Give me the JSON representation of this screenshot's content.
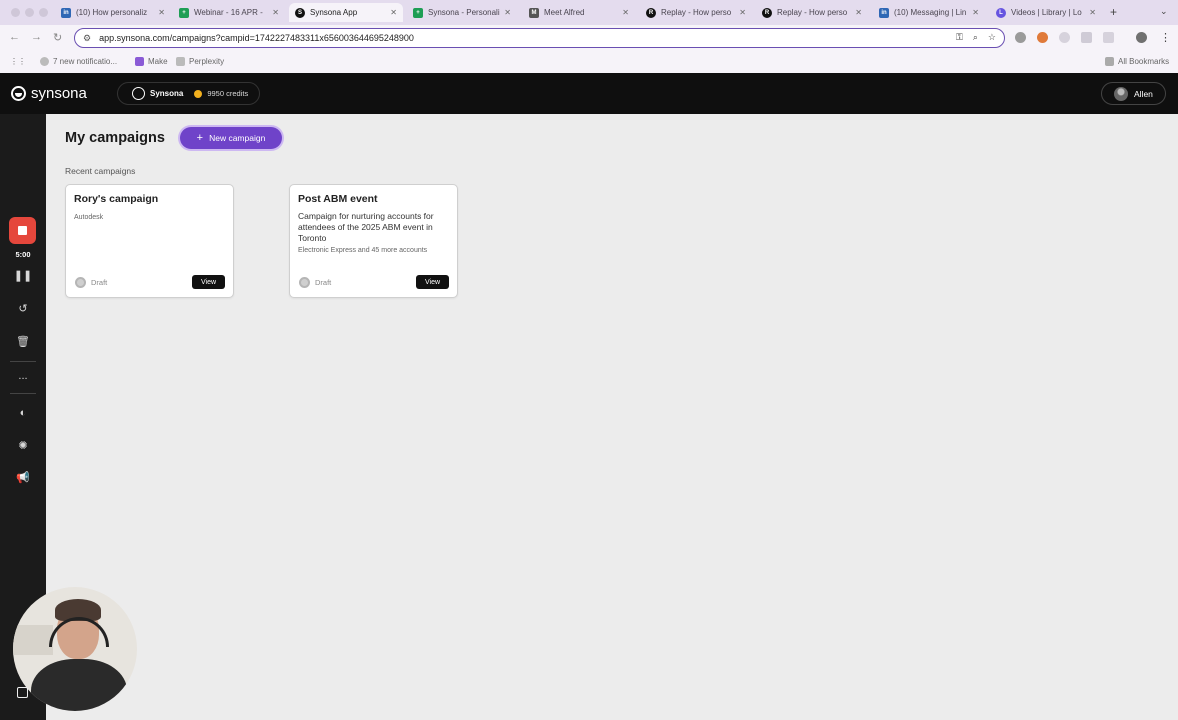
{
  "browser": {
    "tabs": [
      {
        "label": "(10) How personaliz",
        "favicon": "in",
        "color": "#2f67b5",
        "active": false
      },
      {
        "label": "Webinar - 16 APR -",
        "favicon": "+",
        "color": "#1e9e55",
        "active": false
      },
      {
        "label": "Synsona App",
        "favicon": "S",
        "color": "#111111",
        "active": true
      },
      {
        "label": "Synsona - Personali",
        "favicon": "+",
        "color": "#1e9e55",
        "active": false
      },
      {
        "label": "Meet Alfred",
        "favicon": "M",
        "color": "#555555",
        "active": false
      },
      {
        "label": "Replay - How perso",
        "favicon": "R",
        "color": "#111111",
        "active": false
      },
      {
        "label": "Replay - How perso",
        "favicon": "R",
        "color": "#111111",
        "active": false
      },
      {
        "label": "(10) Messaging | Lin",
        "favicon": "in",
        "color": "#2f67b5",
        "active": false
      },
      {
        "label": "Videos | Library | Lo",
        "favicon": "L",
        "color": "#6654e0",
        "active": false
      }
    ],
    "new_tab_glyph": "+",
    "url": "app.synsona.com/campaigns?campid=1742227483311x656003644695248900",
    "bookmarks": [
      {
        "label": "7 new notificatio..."
      },
      {
        "label": "Make"
      },
      {
        "label": "Perplexity"
      }
    ],
    "all_bookmarks_label": "All Bookmarks"
  },
  "header": {
    "brand": "synsona",
    "workspace_name": "Synsona",
    "credits": "9950 credits",
    "user_name": "Allen"
  },
  "recorder": {
    "timer": "5:00",
    "more_glyph": "..."
  },
  "main": {
    "title": "My campaigns",
    "new_campaign_label": "New campaign",
    "recent_label": "Recent campaigns",
    "campaigns": [
      {
        "title": "Rory's campaign",
        "description": "",
        "accounts": "Autodesk",
        "status": "Draft",
        "view_label": "View"
      },
      {
        "title": "Post ABM event",
        "description": "Campaign for nurturing accounts for attendees of the 2025 ABM event in Toronto",
        "accounts": "Electronic Express and 45 more accounts",
        "status": "Draft",
        "view_label": "View"
      }
    ]
  },
  "colors": {
    "accent": "#6f43c9",
    "record": "#e5473c",
    "header_bg": "#0f0f0f"
  }
}
